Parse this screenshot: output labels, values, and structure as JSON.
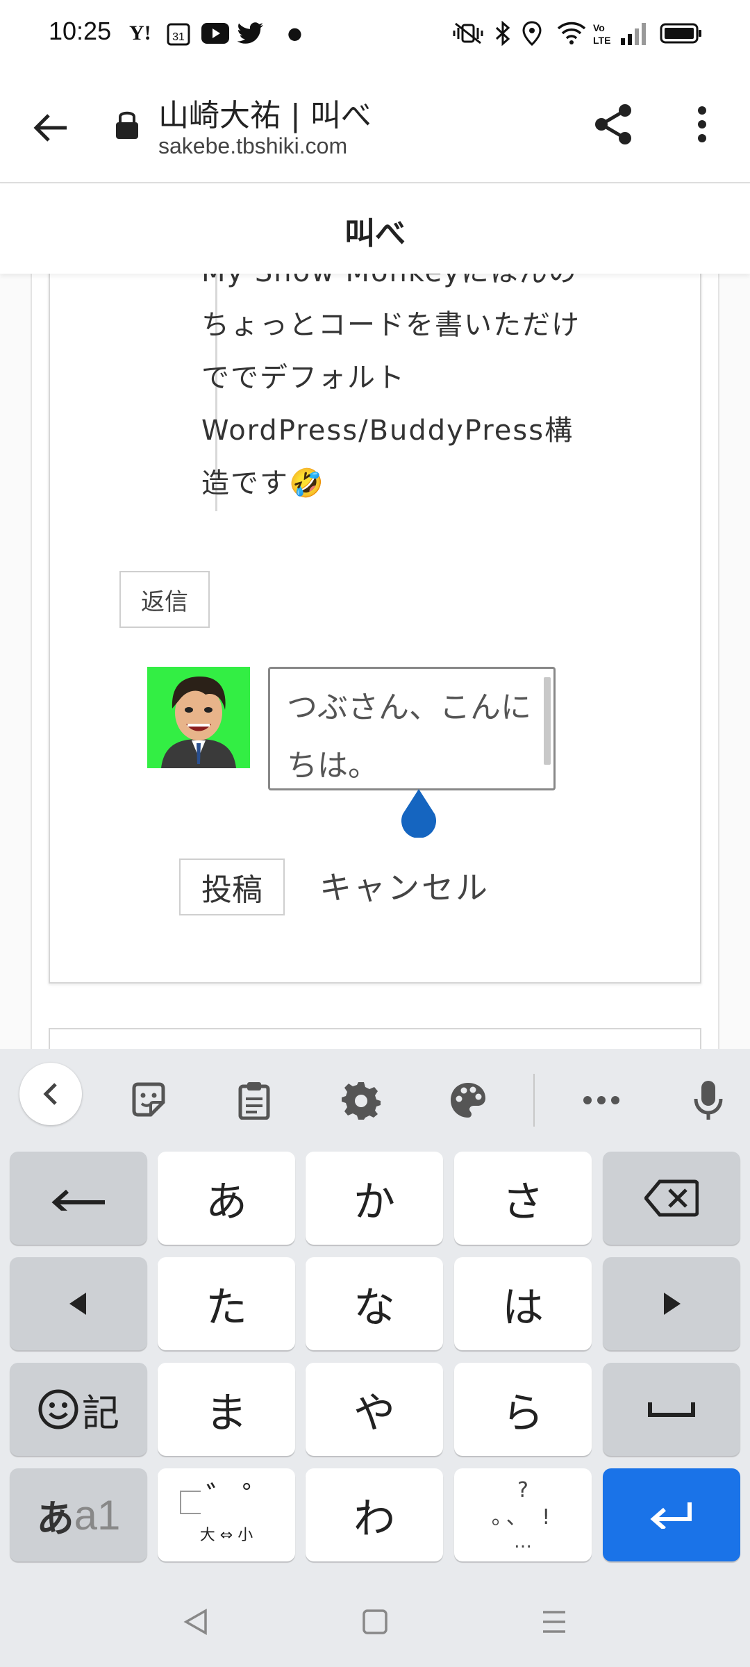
{
  "status_bar": {
    "time": "10:25"
  },
  "browser": {
    "page_title": "山崎大祐 | 叫べ",
    "url": "sakebe.tbshiki.com"
  },
  "site": {
    "name": "叫べ"
  },
  "comment": {
    "lines": [
      "My Snow Monkeyにほんの",
      "ちょっとコードを書いただけ",
      "ででデフォルト",
      "WordPress/BuddyPress構",
      "造です🤣"
    ],
    "reply_label": "返信"
  },
  "reply_form": {
    "text": "つぶさん、こんにちは。",
    "post_label": "投稿",
    "cancel_label": "キャンセル"
  },
  "keyboard": {
    "toolbar_icons": [
      "back-icon",
      "sticker-icon",
      "clipboard-icon",
      "settings-icon",
      "theme-icon",
      "more-icon",
      "mic-icon"
    ],
    "keys": {
      "a": "あ",
      "ka": "か",
      "sa": "さ",
      "ta": "た",
      "na": "な",
      "ha": "は",
      "ma": "ま",
      "ya": "や",
      "ra": "ら",
      "wa": "わ",
      "emoji_label": "記",
      "mode_label_a": "あ",
      "mode_label_b": "a1",
      "dakuten_mark_1": "゛",
      "dakuten_mark_2": "゜",
      "dakuten_sub": "大 ⇔ 小",
      "punct_top": "?",
      "punct_mid": "。、 !",
      "punct_bottom": "…"
    }
  },
  "colors": {
    "accent_orange": "#ff6600",
    "enter_blue": "#1a73e8",
    "cursor_blue": "#1565c0"
  }
}
